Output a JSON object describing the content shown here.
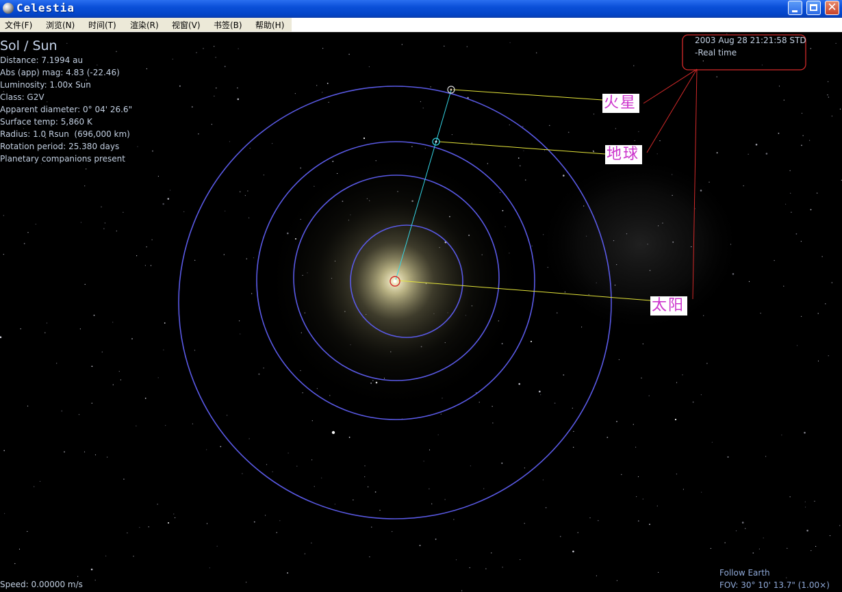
{
  "window": {
    "title": "Celestia",
    "app_icon": "celestia-planet-icon",
    "controls": {
      "minimize_icon": "minimize-icon",
      "maximize_icon": "maximize-icon",
      "close_icon": "close-icon",
      "close_glyph": "✕"
    }
  },
  "menu": {
    "items": [
      {
        "label": "文件(F)"
      },
      {
        "label": "浏览(N)"
      },
      {
        "label": "时间(T)"
      },
      {
        "label": "渲染(R)"
      },
      {
        "label": "视窗(V)"
      },
      {
        "label": "书签(B)"
      },
      {
        "label": "帮助(H)"
      }
    ]
  },
  "hud": {
    "object_title": "Sol / Sun",
    "info_lines": [
      "Distance: 7.1994 au",
      "Abs (app) mag: 4.83 (-22.46)",
      "Luminosity: 1.00x Sun",
      "Class: G2V",
      "Apparent diameter: 0° 04' 26.6\"",
      "Surface temp: 5,860 K",
      "Radius: 1.0 Rsun  (696,000 km)",
      "Rotation period: 25.380 days",
      "Planetary companions present"
    ],
    "time": "2003 Aug 28 21:21:58 STD",
    "time_mode": "-Real time",
    "speed": "Speed: 0.00000 m/s",
    "follow": "Follow Earth",
    "fov": "FOV: 30° 10' 13.7\" (1.00×)"
  },
  "annotations": {
    "mars": "火星",
    "earth": "地球",
    "sun": "太阳"
  },
  "colors": {
    "orbit": "#5a5ae6",
    "earth_vector": "#35d6e6",
    "label_leader": "#e6e63a",
    "annotation_marker": "#d42a2a",
    "hud_text": "#c3d0e2",
    "annotation_text": "#cc33cc"
  }
}
